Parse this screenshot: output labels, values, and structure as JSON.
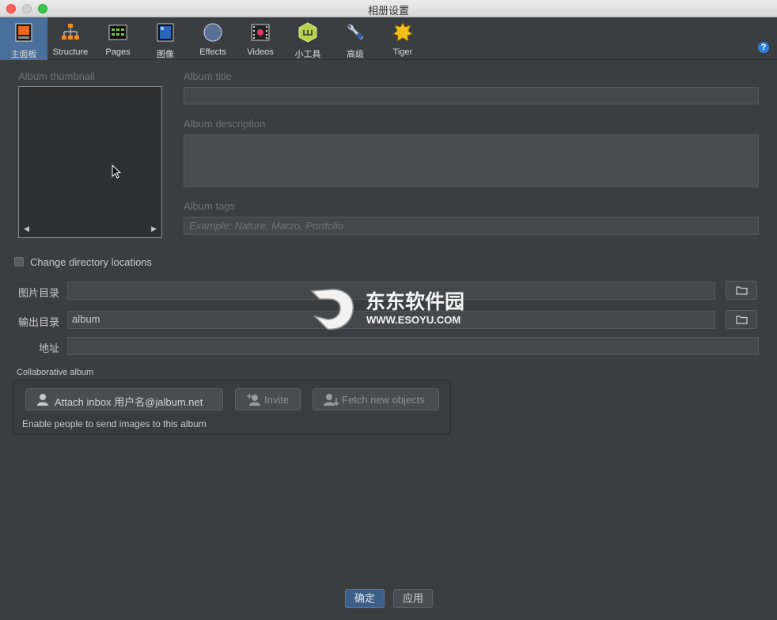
{
  "window": {
    "title": "相册设置"
  },
  "toolbar": {
    "items": [
      {
        "label": "主面板",
        "icon": "panel-icon"
      },
      {
        "label": "Structure",
        "icon": "structure-icon"
      },
      {
        "label": "Pages",
        "icon": "pages-icon"
      },
      {
        "label": "图像",
        "icon": "image-icon"
      },
      {
        "label": "Effects",
        "icon": "effects-icon"
      },
      {
        "label": "Videos",
        "icon": "videos-icon"
      },
      {
        "label": "小工具",
        "icon": "widgets-icon"
      },
      {
        "label": "高级",
        "icon": "advanced-icon"
      },
      {
        "label": "Tiger",
        "icon": "tiger-icon"
      }
    ],
    "help": "?"
  },
  "form": {
    "thumbnail_label": "Album thumbnail",
    "title_label": "Album title",
    "title_value": "",
    "description_label": "Album description",
    "description_value": "",
    "tags_label": "Album tags",
    "tags_placeholder": "Example: Nature, Macro, Portfolio",
    "thumb_prev": "◀",
    "thumb_next": "▶"
  },
  "directories": {
    "change_label": "Change directory locations",
    "image_dir_label": "图片目录",
    "image_dir_value": "",
    "output_dir_label": "输出目录",
    "output_dir_value": "album",
    "address_label": "地址",
    "address_value": ""
  },
  "collab": {
    "title": "Collaborative album",
    "attach_label": "Attach inbox 用户名@jalbum.net",
    "invite_label": "Invite",
    "fetch_label": "Fetch new objects",
    "hint": "Enable people to send images to this album"
  },
  "watermark": {
    "name": "东东软件园",
    "url": "WWW.ESOYU.COM"
  },
  "footer": {
    "ok_label": "确定",
    "apply_label": "应用"
  },
  "colors": {
    "accent": "#4a6f9a",
    "background": "#3b3e41",
    "ok_button": "#3c5f8a"
  }
}
